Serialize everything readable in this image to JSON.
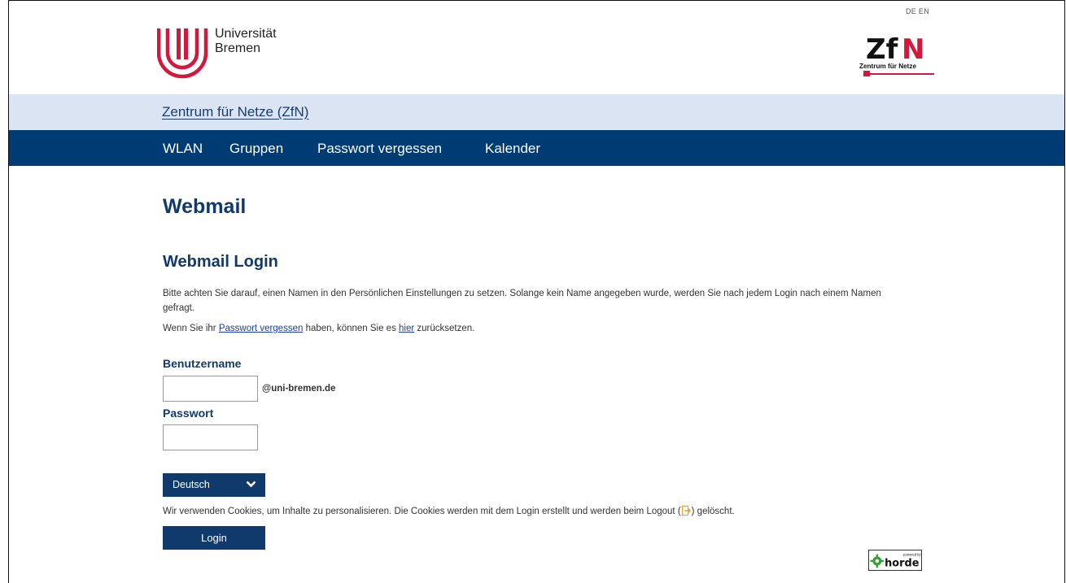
{
  "lang": {
    "de": "DE",
    "en": "EN"
  },
  "logo": {
    "university_line1": "Universität",
    "university_line2": "Bremen",
    "zfn_abbr_1": "Zf",
    "zfn_abbr_2": "N",
    "zfn_caption": "Zentrum für Netze"
  },
  "subheader": {
    "link": "Zentrum für Netze (ZfN)"
  },
  "nav": [
    {
      "label": "WLAN"
    },
    {
      "label": "Gruppen"
    },
    {
      "label": "Passwort vergessen"
    },
    {
      "label": "Kalender"
    }
  ],
  "page": {
    "title": "Webmail",
    "subtitle": "Webmail Login",
    "info_text": "Bitte achten Sie darauf, einen Namen in den Persönlichen Einstellungen zu setzen. Solange kein Name angegeben wurde, werden Sie nach jedem Login nach einem Namen gefragt.",
    "forgot_prefix": "Wenn Sie ihr ",
    "forgot_link": "Passwort vergessen",
    "forgot_middle": " haben, können Sie es ",
    "here_link": "hier",
    "forgot_suffix": " zurücksetzen."
  },
  "form": {
    "username_label": "Benutzername",
    "username_value": "",
    "username_suffix": "@uni-bremen.de",
    "password_label": "Passwort",
    "password_value": "",
    "language_selected": "Deutsch",
    "cookies_before": "Wir verwenden Cookies, um Inhalte zu personalisieren. Die Cookies werden mit dem Login erstellt und werden beim Logout (",
    "cookies_after": ") gelöscht.",
    "login_button": "Login"
  },
  "footer": {
    "powered_by": "powered by",
    "horde": "horde"
  },
  "colors": {
    "primary": "#103a6c",
    "navbar": "#003b73",
    "subband": "#dae4f2",
    "ub_red": "#d4173a",
    "logout_icon": "#f0a030"
  }
}
